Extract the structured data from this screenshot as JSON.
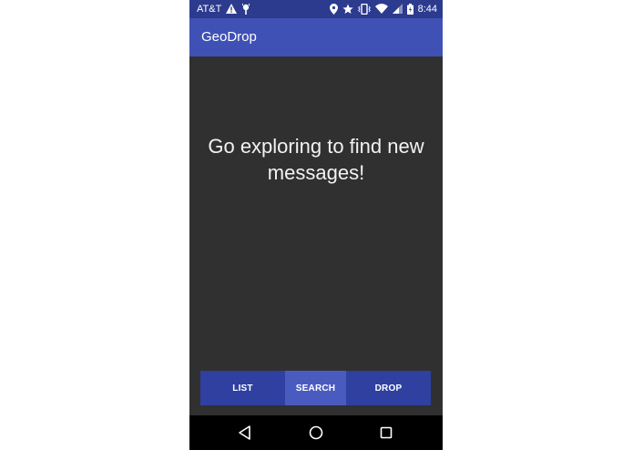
{
  "status_bar": {
    "carrier": "AT&T",
    "time": "8:44",
    "icons": [
      "warning-icon",
      "android-debug-icon",
      "location-icon",
      "star-icon",
      "vibrate-icon",
      "wifi-icon",
      "signal-icon",
      "battery-icon"
    ]
  },
  "app_bar": {
    "title": "GeoDrop"
  },
  "main": {
    "message": "Go exploring to find new messages!"
  },
  "tabs": [
    {
      "label": "LIST",
      "selected": false
    },
    {
      "label": "SEARCH",
      "selected": true
    },
    {
      "label": "DROP",
      "selected": false
    }
  ],
  "nav_bar": {
    "icons": [
      "back-icon",
      "home-icon",
      "recents-icon"
    ]
  },
  "colors": {
    "status_bar": "#2c3b8e",
    "app_bar": "#3f51b5",
    "background": "#303030",
    "tabs": "#2f40a0",
    "tab_selected": "#4a5bc0"
  }
}
